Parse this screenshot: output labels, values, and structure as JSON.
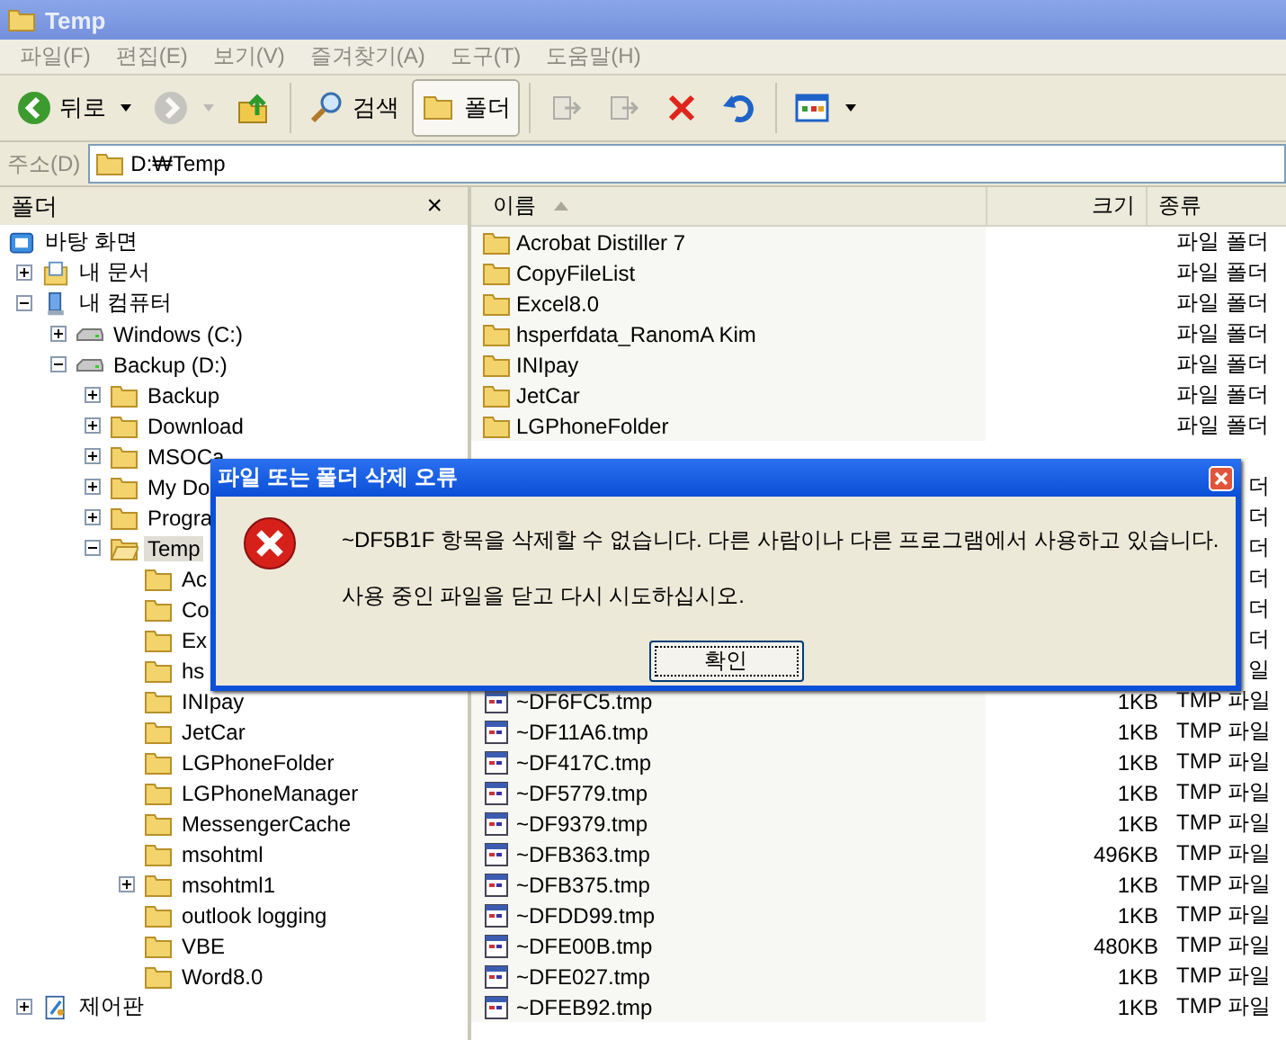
{
  "window": {
    "title": "Temp"
  },
  "menu": [
    "파일(F)",
    "편집(E)",
    "보기(V)",
    "즐겨찾기(A)",
    "도구(T)",
    "도움말(H)"
  ],
  "toolbar": [
    [
      {
        "kind": "back",
        "label": "뒤로",
        "disabled": false,
        "dropdown": true
      },
      {
        "kind": "forward",
        "disabled": true,
        "dropdown": true
      },
      {
        "kind": "up",
        "disabled": false
      }
    ],
    [
      {
        "kind": "search",
        "label": "검색",
        "selected": false
      },
      {
        "kind": "folders",
        "label": "폴더",
        "selected": true
      }
    ],
    [
      {
        "kind": "move",
        "disabled": true
      },
      {
        "kind": "copy",
        "disabled": true
      },
      {
        "kind": "delete",
        "disabled": false
      },
      {
        "kind": "undo",
        "disabled": false
      }
    ],
    [
      {
        "kind": "views",
        "disabled": false,
        "dropdown": true
      }
    ]
  ],
  "address": {
    "label": "주소(D)",
    "value": "D:₩Temp"
  },
  "folder_pane": {
    "title": "폴더",
    "close": "×"
  },
  "tree": [
    {
      "label": "바탕 화면",
      "kind": "desktop",
      "selected": false,
      "children": [
        {
          "label": "내 문서",
          "kind": "documents",
          "expanded": false,
          "selected": false
        },
        {
          "label": "내 컴퓨터",
          "kind": "computer",
          "expanded": true,
          "selected": false,
          "children": [
            {
              "label": "Windows (C:)",
              "kind": "drive",
              "expanded": false,
              "selected": false
            },
            {
              "label": "Backup (D:)",
              "kind": "drive",
              "expanded": true,
              "selected": false,
              "children": [
                {
                  "label": "Backup",
                  "kind": "folder",
                  "expanded": false,
                  "selected": false
                },
                {
                  "label": "Download",
                  "kind": "folder",
                  "expanded": false,
                  "selected": false
                },
                {
                  "label": "MSOCa",
                  "kind": "folder",
                  "expanded": false,
                  "selected": false
                },
                {
                  "label": "My Do",
                  "kind": "folder",
                  "expanded": false,
                  "selected": false
                },
                {
                  "label": "Progra",
                  "kind": "folder",
                  "expanded": false,
                  "selected": false
                },
                {
                  "label": "Temp",
                  "kind": "folder",
                  "expanded": true,
                  "selected": true,
                  "children": [
                    {
                      "label": "Ac",
                      "kind": "folder",
                      "selected": false
                    },
                    {
                      "label": "Co",
                      "kind": "folder",
                      "selected": false
                    },
                    {
                      "label": "Ex",
                      "kind": "folder",
                      "selected": false
                    },
                    {
                      "label": "hs",
                      "kind": "folder",
                      "selected": false
                    },
                    {
                      "label": "INIpay",
                      "kind": "folder",
                      "selected": false
                    },
                    {
                      "label": "JetCar",
                      "kind": "folder",
                      "selected": false
                    },
                    {
                      "label": "LGPhoneFolder",
                      "kind": "folder",
                      "selected": false
                    },
                    {
                      "label": "LGPhoneManager",
                      "kind": "folder",
                      "selected": false
                    },
                    {
                      "label": "MessengerCache",
                      "kind": "folder",
                      "selected": false
                    },
                    {
                      "label": "msohtml",
                      "kind": "folder",
                      "selected": false
                    },
                    {
                      "label": "msohtml1",
                      "kind": "folder",
                      "expanded": false,
                      "selected": false
                    },
                    {
                      "label": "outlook logging",
                      "kind": "folder",
                      "selected": false
                    },
                    {
                      "label": "VBE",
                      "kind": "folder",
                      "selected": false
                    },
                    {
                      "label": "Word8.0",
                      "kind": "folder",
                      "selected": false
                    }
                  ]
                }
              ]
            }
          ]
        },
        {
          "label": "제어판",
          "kind": "control-panel",
          "expanded": false,
          "selected": false
        }
      ]
    }
  ],
  "columns": [
    {
      "label": "이름",
      "sorted": true
    },
    {
      "label": "크기",
      "sorted": false
    },
    {
      "label": "종류",
      "sorted": false
    }
  ],
  "rows": [
    {
      "kind": "folder",
      "name": "Acrobat Distiller 7",
      "type": "파일 폴더"
    },
    {
      "kind": "folder",
      "name": "CopyFileList",
      "type": "파일 폴더"
    },
    {
      "kind": "folder",
      "name": "Excel8.0",
      "type": "파일 폴더"
    },
    {
      "kind": "folder",
      "name": "hsperfdata_RanomA Kim",
      "type": "파일 폴더"
    },
    {
      "kind": "folder",
      "name": "INIpay",
      "type": "파일 폴더"
    },
    {
      "kind": "folder",
      "name": "JetCar",
      "type": "파일 폴더"
    },
    {
      "kind": "folder",
      "name": "LGPhoneFolder",
      "type": "파일 폴더"
    },
    {
      "kind": "covered"
    },
    {
      "kind": "covered",
      "type": "더"
    },
    {
      "kind": "covered",
      "type": "더"
    },
    {
      "kind": "covered",
      "type": "더"
    },
    {
      "kind": "covered",
      "type": "더"
    },
    {
      "kind": "covered",
      "type": "더"
    },
    {
      "kind": "covered",
      "type": "더"
    },
    {
      "kind": "covered",
      "type": "일"
    },
    {
      "kind": "file",
      "name": "~DF6FC5.tmp",
      "size": "1KB",
      "type": "TMP 파일"
    },
    {
      "kind": "file",
      "name": "~DF11A6.tmp",
      "size": "1KB",
      "type": "TMP 파일"
    },
    {
      "kind": "file",
      "name": "~DF417C.tmp",
      "size": "1KB",
      "type": "TMP 파일"
    },
    {
      "kind": "file",
      "name": "~DF5779.tmp",
      "size": "1KB",
      "type": "TMP 파일"
    },
    {
      "kind": "file",
      "name": "~DF9379.tmp",
      "size": "1KB",
      "type": "TMP 파일"
    },
    {
      "kind": "file",
      "name": "~DFB363.tmp",
      "size": "496KB",
      "type": "TMP 파일"
    },
    {
      "kind": "file",
      "name": "~DFB375.tmp",
      "size": "1KB",
      "type": "TMP 파일"
    },
    {
      "kind": "file",
      "name": "~DFDD99.tmp",
      "size": "1KB",
      "type": "TMP 파일"
    },
    {
      "kind": "file",
      "name": "~DFE00B.tmp",
      "size": "480KB",
      "type": "TMP 파일"
    },
    {
      "kind": "file",
      "name": "~DFE027.tmp",
      "size": "1KB",
      "type": "TMP 파일"
    },
    {
      "kind": "file",
      "name": "~DFEB92.tmp",
      "size": "1KB",
      "type": "TMP 파일"
    }
  ],
  "dialog": {
    "title": "파일 또는 폴더 삭제 오류",
    "message": [
      "~DF5B1F 항목을 삭제할 수 없습니다. 다른 사람이나 다른 프로그램에서 사용하고 있습니다.",
      "사용 중인 파일을 닫고 다시 시도하십시오."
    ],
    "button": "확인"
  }
}
